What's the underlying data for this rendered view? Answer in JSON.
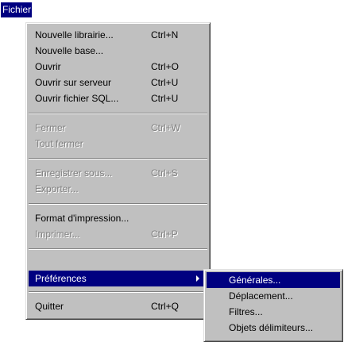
{
  "menubar": {
    "fichier": "Fichier"
  },
  "menu": {
    "items": [
      {
        "label": "Nouvelle librairie...",
        "shortcut": "Ctrl+N",
        "enabled": true
      },
      {
        "label": "Nouvelle base...",
        "shortcut": "",
        "enabled": true
      },
      {
        "label": "Ouvrir",
        "shortcut": "Ctrl+O",
        "enabled": true
      },
      {
        "label": "Ouvrir sur serveur",
        "shortcut": "Ctrl+U",
        "enabled": true
      },
      {
        "label": "Ouvrir fichier SQL...",
        "shortcut": "Ctrl+U",
        "enabled": true
      },
      {
        "label": "Fermer",
        "shortcut": "Ctrl+W",
        "enabled": false
      },
      {
        "label": "Tout fermer",
        "shortcut": "",
        "enabled": false
      },
      {
        "label": "Enregistrer sous...",
        "shortcut": "Ctrl+S",
        "enabled": false
      },
      {
        "label": "Exporter...",
        "shortcut": "",
        "enabled": false
      },
      {
        "label": "Format d'impression...",
        "shortcut": "",
        "enabled": true
      },
      {
        "label": "Imprimer...",
        "shortcut": "Ctrl+P",
        "enabled": false
      },
      {
        "label": "Préférences",
        "shortcut": "",
        "enabled": true,
        "selected": true,
        "submenu": true
      },
      {
        "label": "Quitter",
        "shortcut": "Ctrl+Q",
        "enabled": true
      }
    ]
  },
  "submenu": {
    "items": [
      {
        "label": "Générales...",
        "selected": true
      },
      {
        "label": "Déplacement..."
      },
      {
        "label": "Filtres..."
      },
      {
        "label": "Objets délimiteurs..."
      }
    ]
  },
  "colors": {
    "menu_bg": "#c0c0c0",
    "highlight": "#000080",
    "disabled": "#808080"
  },
  "icons": {
    "submenu_arrow": "triangle-right-icon"
  }
}
